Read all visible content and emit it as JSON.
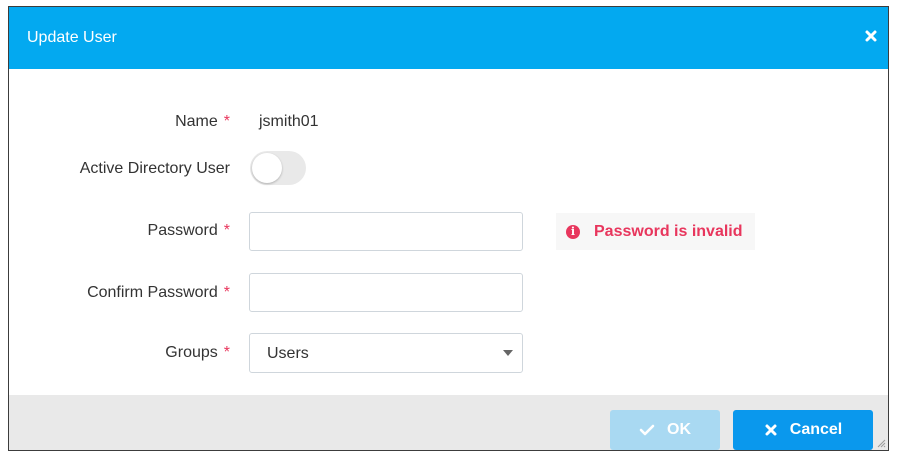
{
  "dialog": {
    "title": "Update User",
    "close_icon": "close-icon"
  },
  "form": {
    "name": {
      "label": "Name",
      "required_mark": "*",
      "value": "jsmith01"
    },
    "active_directory": {
      "label": "Active Directory User",
      "enabled": false
    },
    "password": {
      "label": "Password",
      "required_mark": "*",
      "value": "",
      "error": "Password is invalid",
      "error_icon": "info-circle-icon"
    },
    "confirm_password": {
      "label": "Confirm Password",
      "required_mark": "*",
      "value": ""
    },
    "groups": {
      "label": "Groups",
      "required_mark": "*",
      "value": "Users"
    }
  },
  "footer": {
    "ok_label": "OK",
    "ok_icon": "check-icon",
    "ok_enabled": false,
    "cancel_label": "Cancel",
    "cancel_icon": "close-icon"
  },
  "colors": {
    "header": "#03a9f0",
    "error": "#e8365d",
    "primary_button": "#0a98ed",
    "disabled_button": "#a9d9f2"
  }
}
